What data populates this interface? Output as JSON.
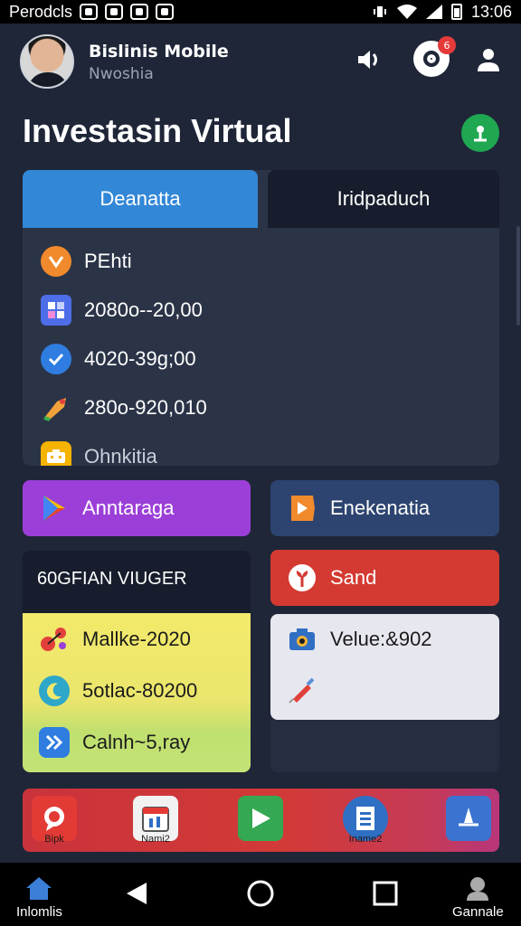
{
  "status_bar": {
    "carrier": "Perodcls",
    "time": "13:06"
  },
  "header": {
    "app_name": "Bislinis Mobile",
    "subtitle": "Nwoshia",
    "notification_count": "6"
  },
  "page": {
    "title": "Investasin Virtual"
  },
  "tabs": [
    {
      "label": "Deanatta",
      "active": true
    },
    {
      "label": "Iridpaduch",
      "active": false
    }
  ],
  "list": [
    {
      "icon": "heart-icon",
      "text": "PEhti"
    },
    {
      "icon": "grid-icon",
      "text": "2080o--20,00"
    },
    {
      "icon": "check-icon",
      "text": "4020-39g;00"
    },
    {
      "icon": "tag-icon",
      "text": "280o-920,010"
    },
    {
      "icon": "briefcase-icon",
      "text": "Ohnkitia"
    }
  ],
  "actions": {
    "purple": "Anntaraga",
    "navy": "Enekenatia",
    "red": "Sand"
  },
  "left_card": {
    "caption": "60GFIAN VIUGER",
    "rows": [
      "Mallke-2020",
      "5otlac-80200",
      "Calnh~5,ray"
    ]
  },
  "right_card": {
    "rows": [
      "Velue:&902",
      ""
    ]
  },
  "dock": {
    "labels": [
      "Bipk",
      "Nami2",
      "",
      "Iname2",
      ""
    ]
  },
  "navbar": {
    "home_label": "Inlomlis",
    "profile_label": "Gannale"
  },
  "colors": {
    "background": "#1f2638",
    "accent_blue": "#3287d6",
    "purple": "#9b3fd8",
    "red": "#d43a32",
    "green": "#1fa851"
  }
}
